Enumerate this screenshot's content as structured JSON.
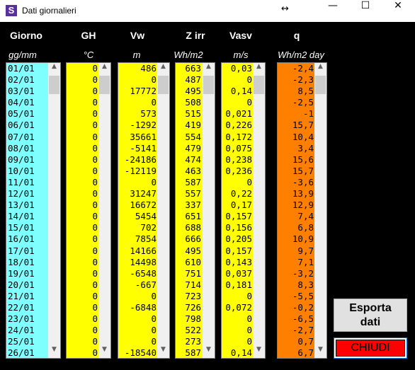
{
  "window": {
    "title": "Dati giornalieri",
    "app_icon_letter": "S",
    "resize_glyph": "↔",
    "minimize_glyph": "—",
    "maximize_glyph": "☐",
    "close_glyph": "✕"
  },
  "columns": [
    {
      "header": "Giorno",
      "unit": "gg/mm",
      "color": "#80ffff",
      "align": "left",
      "values": [
        "01/01",
        "02/01",
        "03/01",
        "04/01",
        "05/01",
        "06/01",
        "07/01",
        "08/01",
        "09/01",
        "10/01",
        "11/01",
        "12/01",
        "13/01",
        "14/01",
        "15/01",
        "16/01",
        "17/01",
        "18/01",
        "19/01",
        "20/01",
        "21/01",
        "22/01",
        "23/01",
        "24/01",
        "25/01",
        "26/01"
      ]
    },
    {
      "header": "GH",
      "unit": "°C",
      "color": "#ffff00",
      "align": "right",
      "values": [
        "0",
        "0",
        "0",
        "0",
        "0",
        "0",
        "0",
        "0",
        "0",
        "0",
        "0",
        "0",
        "0",
        "0",
        "0",
        "0",
        "0",
        "0",
        "0",
        "0",
        "0",
        "0",
        "0",
        "0",
        "0",
        "0"
      ]
    },
    {
      "header": "Vw",
      "unit": "m",
      "color": "#ffff00",
      "align": "right",
      "values": [
        "486",
        "0",
        "17772",
        "0",
        "573",
        "-1292",
        "35661",
        "-5141",
        "-24186",
        "-12119",
        "0",
        "31247",
        "16672",
        "5454",
        "702",
        "7854",
        "14166",
        "14498",
        "-6548",
        "-667",
        "0",
        "-6848",
        "0",
        "0",
        "0",
        "-18540"
      ]
    },
    {
      "header": "Z irr",
      "unit": "Wh/m2",
      "color": "#ffff00",
      "align": "right",
      "values": [
        "663",
        "487",
        "495",
        "508",
        "515",
        "419",
        "554",
        "479",
        "474",
        "463",
        "587",
        "557",
        "337",
        "651",
        "688",
        "666",
        "495",
        "610",
        "751",
        "714",
        "723",
        "726",
        "798",
        "522",
        "273",
        "587"
      ]
    },
    {
      "header": "Vasv",
      "unit": "m/s",
      "color": "#ffff00",
      "align": "right",
      "values": [
        "0,03",
        "0",
        "0,14",
        "0",
        "0,021",
        "0,226",
        "0,172",
        "0,075",
        "0,238",
        "0,236",
        "0",
        "0,22",
        "0,17",
        "0,157",
        "0,156",
        "0,205",
        "0,157",
        "0,143",
        "0,037",
        "0,181",
        "0",
        "0,072",
        "0",
        "0",
        "0",
        "0,14"
      ]
    },
    {
      "header": "q",
      "unit": "Wh/m2 day",
      "color": "#ff8000",
      "align": "right",
      "values": [
        "-2,4",
        "-2,3",
        "8,5",
        "-2,5",
        "-1",
        "15,7",
        "10,4",
        "3,4",
        "15,6",
        "15,7",
        "-3,6",
        "13,9",
        "12,9",
        "7,4",
        "6,8",
        "10,9",
        "9,7",
        "7,1",
        "-3,2",
        "8,3",
        "-5,5",
        "-0,2",
        "-6,5",
        "-2,7",
        "0,7",
        "6,7"
      ]
    }
  ],
  "buttons": {
    "export_label": "Esporta dati",
    "close_label": "CHIUDI"
  },
  "scroll_arrows": {
    "up": "▲",
    "down": "▼"
  }
}
